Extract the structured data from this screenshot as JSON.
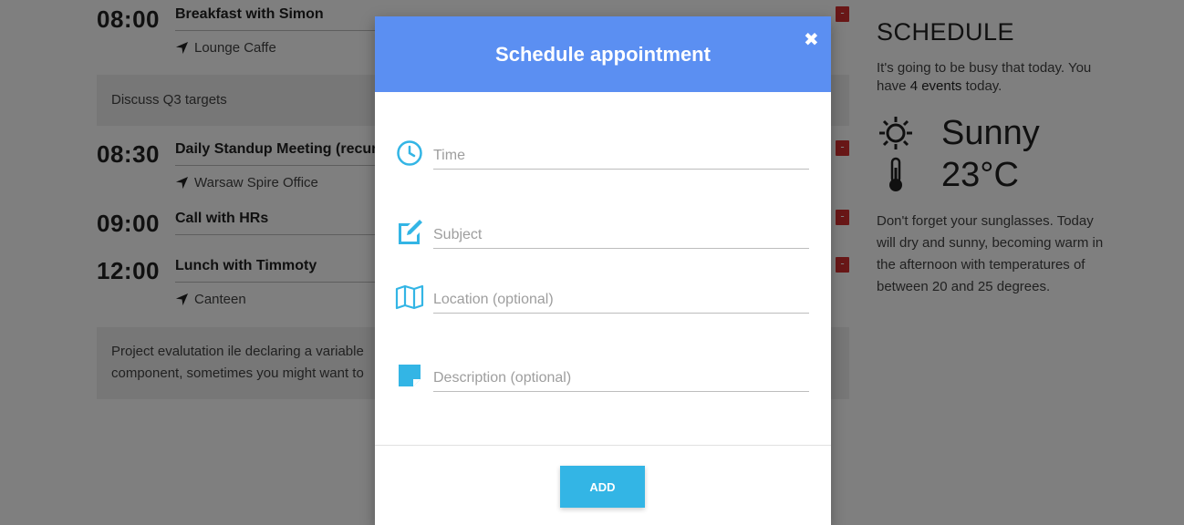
{
  "events": [
    {
      "time": "08:00",
      "title": "Breakfast with Simon",
      "location": "Lounge Caffe",
      "description": "Discuss Q3 targets",
      "delete_label": "-"
    },
    {
      "time": "08:30",
      "title": "Daily Standup Meeting (recurring)",
      "location": "Warsaw Spire Office",
      "delete_label": "-"
    },
    {
      "time": "09:00",
      "title": "Call with HRs",
      "delete_label": "-"
    },
    {
      "time": "12:00",
      "title": "Lunch with Timmoty",
      "location": "Canteen",
      "description_line1": "Project evalutation ile declaring a variable",
      "description_line2": "component, sometimes you might want to",
      "delete_label": "-"
    }
  ],
  "sidebar": {
    "heading": "SCHEDULE",
    "intro_prefix": "It's going to be busy that today. You have",
    "event_count": "4 events",
    "intro_suffix": "today.",
    "weather": "Sunny",
    "temperature": "23°C",
    "note": "Don't forget your sunglasses. Today will dry and sunny, becoming warm in the afternoon with temperatures of between 20 and 25 degrees."
  },
  "modal": {
    "title": "Schedule appointment",
    "close_label": "✖",
    "fields": {
      "time_placeholder": "Time",
      "subject_placeholder": "Subject",
      "location_placeholder": "Location (optional)",
      "description_placeholder": "Description (optional)"
    },
    "add_label": "ADD"
  },
  "colors": {
    "header": "#5b8ff2",
    "icon": "#33b5e5",
    "button": "#33b5e5",
    "delete": "#d32f2f"
  }
}
